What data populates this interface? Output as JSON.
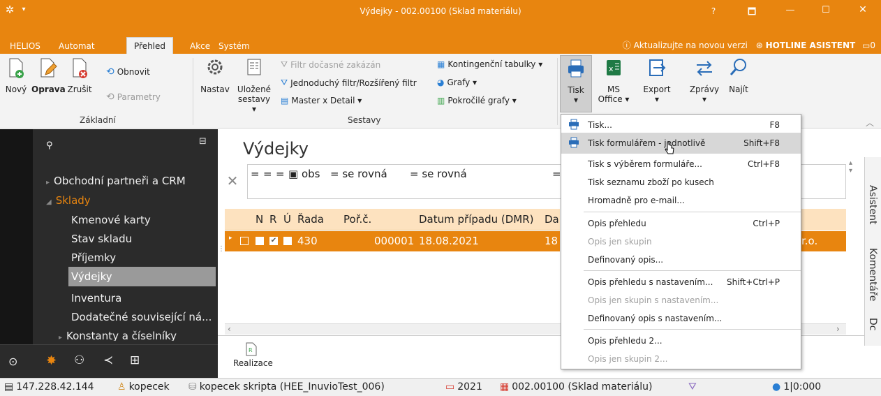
{
  "window": {
    "title": "Výdejky - 002.00100 (Sklad materiálu)",
    "help": "?",
    "controls": [
      "🗖",
      "—",
      "☐",
      "✕"
    ]
  },
  "menu": {
    "tabs": [
      "HELIOS",
      "Automat",
      "Přehled",
      "Akce",
      "Systém"
    ],
    "active": "Přehled",
    "update_notice": "Aktualizujte na novou verzi",
    "hotline": "HOTLINE ASISTENT",
    "msg_count": "0"
  },
  "ribbon": {
    "novy": "Nový",
    "oprava": "Oprava",
    "zrusit": "Zrušit",
    "obnovit": "Obnovit",
    "parametry": "Parametry",
    "group_zakladni": "Základní",
    "nastav": "Nastav",
    "ulozene": "Uložené",
    "sestavy": "sestavy ▾",
    "filtr_docasne": "Filtr dočasné zakázán",
    "jednoduchy_filtr": "Jednoduchý filtr/Rozšířený filtr",
    "master_detail": "Master x Detail ▾",
    "kontingencni": "Kontingenční tabulky ▾",
    "grafy": "Grafy ▾",
    "pokrocile_grafy": "Pokročilé grafy ▾",
    "group_sestavy": "Sestavy",
    "tisk": "Tisk",
    "ms": "MS",
    "office": "Office ▾",
    "export": "Export",
    "zpravy": "Zprávy",
    "najit": "Najít"
  },
  "nav": {
    "items": [
      "Obchodní partneři a CRM",
      "Sklady",
      "Kmenové karty",
      "Stav skladu",
      "Příjemky",
      "Výdejky",
      "Inventura",
      "Dodatečné související ná...",
      "Konstanty a číselníky"
    ],
    "active": "Výdejky"
  },
  "grid": {
    "title": "Výdejky",
    "filter_ops": [
      "=",
      "=",
      "=",
      "obs",
      "= se rovná",
      "= se rovná",
      "="
    ],
    "columns": [
      "N",
      "R",
      "Ú",
      "Řada",
      "Poř.č.",
      "Datum případu (DMR)",
      "Da"
    ],
    "row": {
      "rada": "430",
      "porc": "000001",
      "datum": "18.08.2021",
      "da": "18",
      "tail": "r.o."
    },
    "realizace": "Realizace"
  },
  "side_tabs": [
    "Asistent",
    "Komentáře",
    "Dc"
  ],
  "dropdown": {
    "items": [
      {
        "label": "Tisk...",
        "shortcut": "F8",
        "icon": "printer-icon",
        "disabled": false
      },
      {
        "label": "Tisk formulářem - jednotlivě",
        "shortcut": "Shift+F8",
        "icon": "printer-icon",
        "disabled": false,
        "highlight": true
      },
      {
        "label": "Tisk s výběrem formuláře...",
        "shortcut": "Ctrl+F8",
        "disabled": false
      },
      {
        "label": "Tisk seznamu zboží po kusech",
        "shortcut": "",
        "disabled": false
      },
      {
        "label": "Hromadně pro e-mail...",
        "shortcut": "",
        "disabled": false
      },
      {
        "label": "Opis přehledu",
        "shortcut": "Ctrl+P",
        "disabled": false
      },
      {
        "label": "Opis jen skupin",
        "shortcut": "",
        "disabled": true
      },
      {
        "label": "Definovaný opis...",
        "shortcut": "",
        "disabled": false
      },
      {
        "label": "Opis přehledu s nastavením...",
        "shortcut": "Shift+Ctrl+P",
        "disabled": false
      },
      {
        "label": "Opis jen skupin s nastavením...",
        "shortcut": "",
        "disabled": true
      },
      {
        "label": "Definovaný opis s nastavením...",
        "shortcut": "",
        "disabled": false
      },
      {
        "label": "Opis přehledu 2...",
        "shortcut": "",
        "disabled": false
      },
      {
        "label": "Opis jen skupin 2...",
        "shortcut": "",
        "disabled": true
      }
    ]
  },
  "status": {
    "ip": "147.228.42.144",
    "user": "kopecek",
    "db": "kopecek skripta (HEE_InuvioTest_006)",
    "year": "2021",
    "warehouse": "002.00100 (Sklad materiálu)",
    "counter": "1|0:000"
  },
  "colors": {
    "accent": "#e8850f",
    "nav_bg": "#2b2b2b",
    "nav_active": "#9a9a9a"
  }
}
